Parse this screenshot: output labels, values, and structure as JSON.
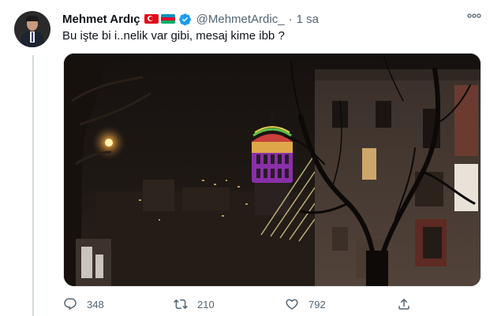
{
  "tweet": {
    "author_name": "Mehmet Ardıç",
    "author_handle": "@MehmetArdic_",
    "separator": "·",
    "time": "1 sa",
    "text": "Bu işte bi i..nelik var gibi, mesaj kime ibb ?",
    "verified_color": "#1d9bf0"
  },
  "flags": [
    "turkey-flag-emoji",
    "azerbaijan-flag-emoji"
  ],
  "media": {
    "type": "photo",
    "subject": "Galata Tower lit with purple and rainbow lights at night"
  },
  "actions": {
    "reply_count": "348",
    "retweet_count": "210",
    "like_count": "792"
  },
  "colors": {
    "text_primary": "#0f1419",
    "text_secondary": "#536471",
    "thread_line": "#cfd9de"
  }
}
